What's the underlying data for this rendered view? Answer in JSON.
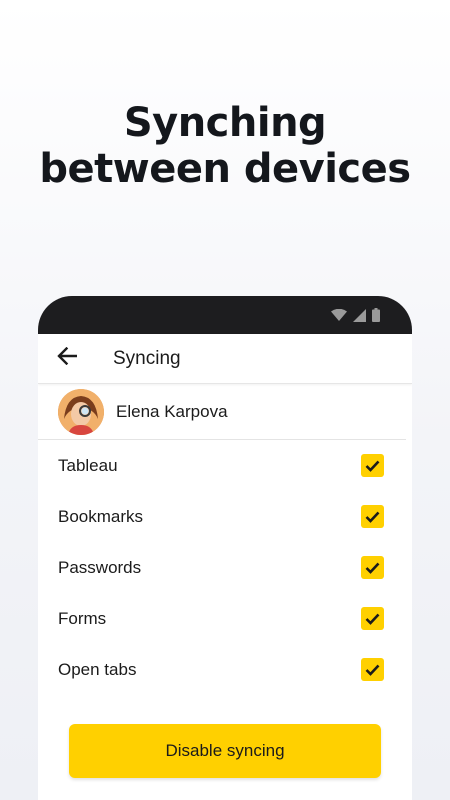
{
  "headline": {
    "line1": "Synching",
    "line2": "between devices"
  },
  "statusbar": {
    "icons": [
      "wifi-icon",
      "signal-icon",
      "battery-icon"
    ]
  },
  "appbar": {
    "back_icon": "arrow-left-icon",
    "title": "Syncing"
  },
  "account": {
    "name": "Elena Karpova"
  },
  "sync_items": [
    {
      "label": "Tableau",
      "checked": true
    },
    {
      "label": "Bookmarks",
      "checked": true
    },
    {
      "label": "Passwords",
      "checked": true
    },
    {
      "label": "Forms",
      "checked": true
    },
    {
      "label": "Open tabs",
      "checked": true
    }
  ],
  "actions": {
    "disable_label": "Disable syncing"
  },
  "colors": {
    "accent": "#ffd000",
    "phone_frame": "#1d1d1f",
    "text": "#14171c"
  }
}
